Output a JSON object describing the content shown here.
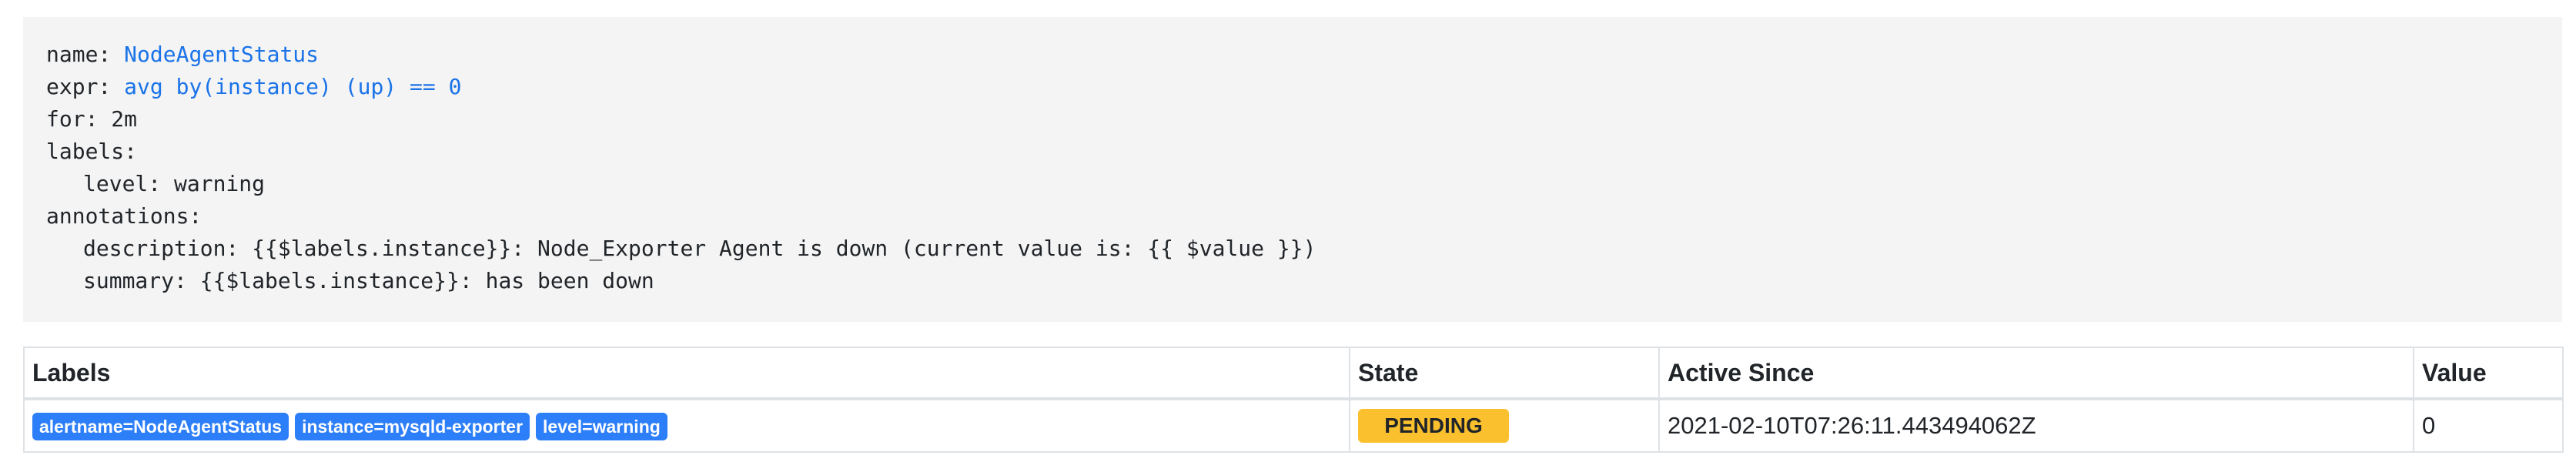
{
  "rule": {
    "name_key": "name:",
    "name_value": "NodeAgentStatus",
    "expr_key": "expr:",
    "expr_value": "avg by(instance) (up) == 0",
    "for_line": "for: 2m",
    "labels_key": "labels:",
    "level_line": "level: warning",
    "annotations_key": "annotations:",
    "description_line": "description: {{$labels.instance}}: Node_Exporter Agent is down (current value is: {{ $value }})",
    "summary_line": "summary: {{$labels.instance}}: has been down"
  },
  "table": {
    "headers": [
      "Labels",
      "State",
      "Active Since",
      "Value"
    ],
    "rows": [
      {
        "labels": [
          "alertname=NodeAgentStatus",
          "instance=mysqld-exporter",
          "level=warning"
        ],
        "state": "PENDING",
        "active_since": "2021-02-10T07:26:11.443494062Z",
        "value": "0"
      }
    ]
  },
  "colors": {
    "code_bg": "#f4f4f4",
    "highlight": "#1a73e8",
    "label_badge": "#2d7ff9",
    "pending_badge": "#fbc02d"
  }
}
